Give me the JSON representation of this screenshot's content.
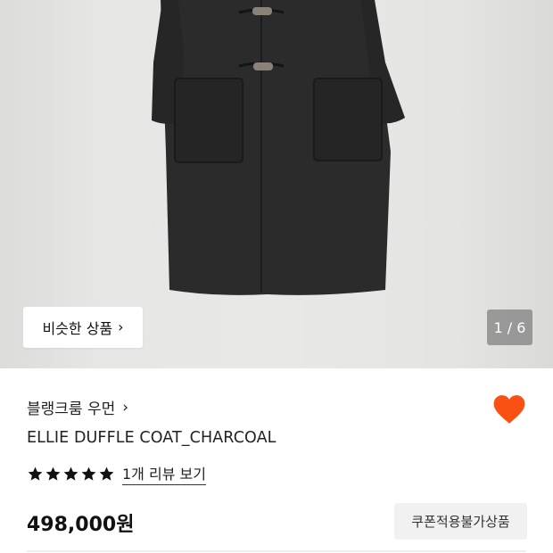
{
  "gallery": {
    "similar_button_label": "비슷한 상품",
    "counter": "1 / 6"
  },
  "product": {
    "brand": "블랭크룸 우먼",
    "name": "ELLIE DUFFLE COAT_CHARCOAL",
    "rating_stars": 5,
    "review_link": "1개 리뷰 보기",
    "price": "498,000원",
    "coupon_badge": "쿠폰적용불가상품",
    "wishlisted": true
  },
  "colors": {
    "heart": "#fa5014",
    "coat": "#2b2b2b"
  }
}
